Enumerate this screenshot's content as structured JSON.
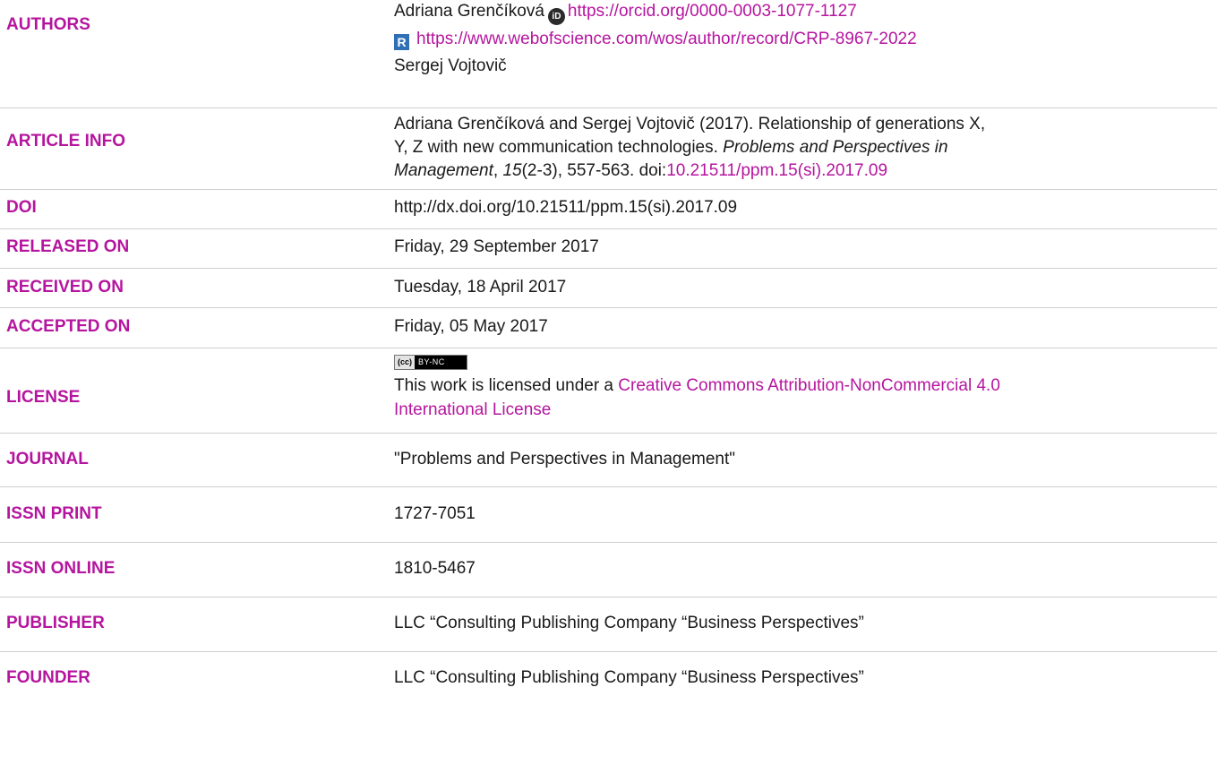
{
  "authors": {
    "label": "AUTHORS",
    "author1_name": "Adriana Grenčíková",
    "orcid_icon_text": "iD",
    "orcid_url": "https://orcid.org/0000-0003-1077-1127",
    "researcherid_icon_text": "R",
    "wos_url": "https://www.webofscience.com/wos/author/record/CRP-8967-2022",
    "author2_name": "Sergej Vojtovič"
  },
  "article_info": {
    "label": "ARTICLE INFO",
    "line1": "Adriana Grenčíková and Sergej Vojtovič (2017). Relationship of generations X,",
    "line2": "Y, Z with new communication technologies.",
    "journal_italic_1": "Problems and Perspectives in",
    "journal_italic_2": "Management",
    "volume": "15",
    "pages": "(2-3), 557-563. doi:",
    "doi_link": "10.21511/ppm.15(si).2017.09"
  },
  "doi": {
    "label": "DOI",
    "value": "http://dx.doi.org/10.21511/ppm.15(si).2017.09"
  },
  "released": {
    "label": "RELEASED ON",
    "value": "Friday, 29 September 2017"
  },
  "received": {
    "label": "RECEIVED ON",
    "value": "Tuesday, 18 April 2017"
  },
  "accepted": {
    "label": "ACCEPTED ON",
    "value": "Friday, 05 May 2017"
  },
  "license": {
    "label": "LICENSE",
    "badge_cc": "(cc)",
    "badge_terms": "BY-NC",
    "text": "This work is licensed under a",
    "link_line1": "Creative Commons Attribution-NonCommercial 4.0",
    "link_line2": "International License"
  },
  "journal": {
    "label": "JOURNAL",
    "value": "\"Problems and Perspectives in Management\""
  },
  "issn_print": {
    "label": "ISSN PRINT",
    "value": "1727-7051"
  },
  "issn_online": {
    "label": "ISSN ONLINE",
    "value": "1810-5467"
  },
  "publisher": {
    "label": "PUBLISHER",
    "value": "LLC “Consulting Publishing Company “Business Perspectives”"
  },
  "founder": {
    "label": "FOUNDER",
    "value": "LLC “Consulting Publishing Company “Business Perspectives”"
  },
  "colors": {
    "label_accent": "#b5159e",
    "link": "#b5159e",
    "text": "#1a1a1a",
    "divider": "#cfcfcf"
  }
}
